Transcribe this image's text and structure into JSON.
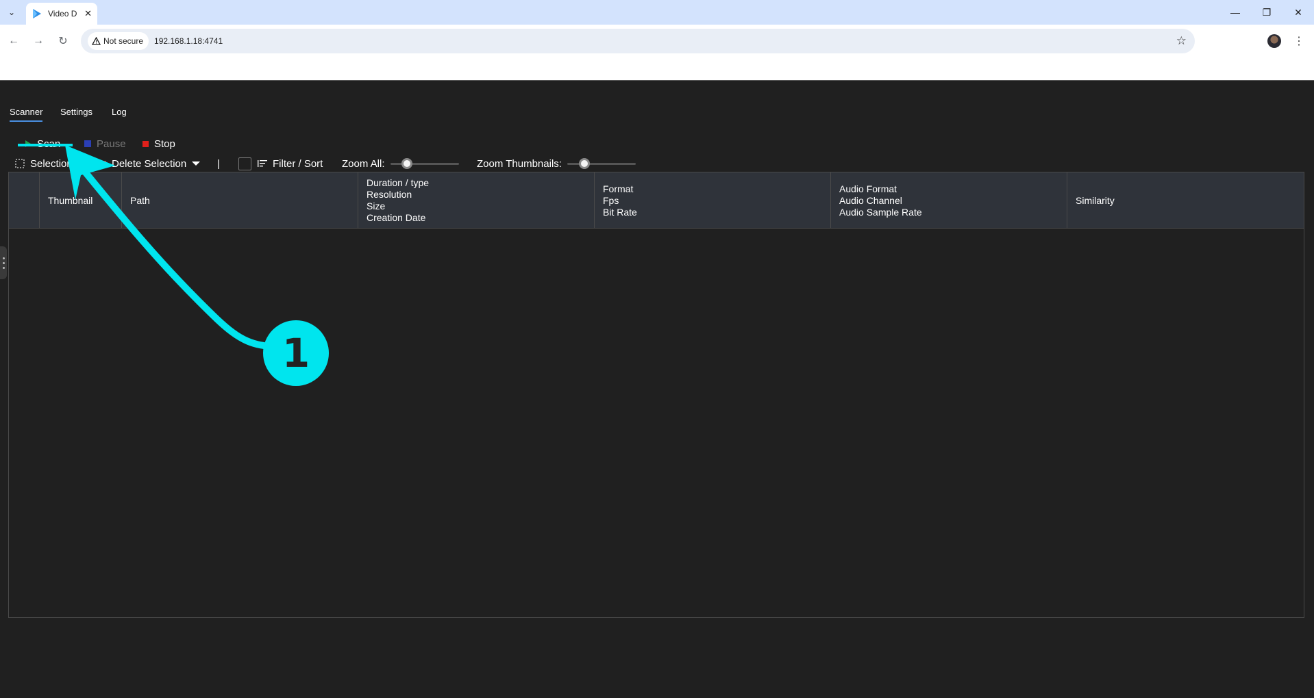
{
  "browser": {
    "tab_title": "Video D",
    "security_label": "Not secure",
    "url": "192.168.1.18:4741"
  },
  "app": {
    "tabs": [
      {
        "label": "Scanner",
        "active": true
      },
      {
        "label": "Settings",
        "active": false
      },
      {
        "label": "Log",
        "active": false
      }
    ],
    "actions": {
      "scan": "Scan",
      "pause": "Pause",
      "stop": "Stop"
    },
    "row2": {
      "selection": "Selection",
      "delete_selection": "Delete Selection",
      "separator": "|",
      "filter_sort": "Filter / Sort",
      "zoom_all": "Zoom All:",
      "zoom_all_value": 0.2,
      "zoom_thumbnails": "Zoom Thumbnails:",
      "zoom_thumbnails_value": 0.2
    },
    "columns": {
      "thumbnail": "Thumbnail",
      "path": "Path",
      "duration": "Duration / type",
      "resolution": "Resolution",
      "size": "Size",
      "creation_date": "Creation Date",
      "format": "Format",
      "fps": "Fps",
      "bit_rate": "Bit Rate",
      "audio_format": "Audio Format",
      "audio_channel": "Audio Channel",
      "audio_sample_rate": "Audio Sample Rate",
      "similarity": "Similarity"
    },
    "rows": []
  },
  "annotation": {
    "number": "1",
    "color": "#00e5ee"
  },
  "colors": {
    "scan_icon": "#1fa34a",
    "pause_icon": "#2b3fb5",
    "stop_icon": "#e0201b",
    "delete_icon": "#e0201b",
    "accent": "#4a90e2"
  }
}
